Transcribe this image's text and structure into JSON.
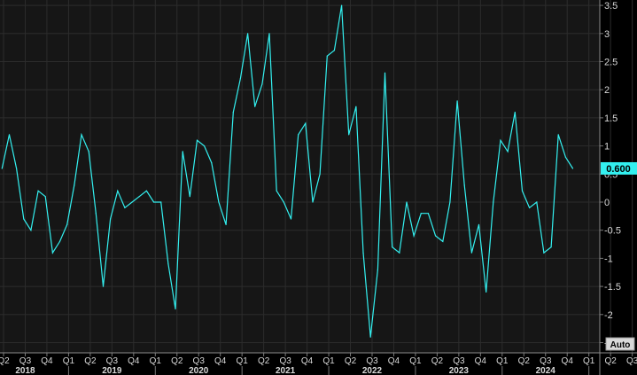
{
  "chart_data": {
    "type": "line",
    "title": "",
    "xlabel": "",
    "ylabel": "",
    "x": [
      "2017-Q4",
      "2017-Q4",
      "2018-Q1",
      "2018-Q1",
      "2018-Q1",
      "2018-Q2",
      "2018-Q2",
      "2018-Q2",
      "2018-Q3",
      "2018-Q3",
      "2018-Q3",
      "2018-Q4",
      "2018-Q4",
      "2018-Q4",
      "2019-Q1",
      "2019-Q1",
      "2019-Q1",
      "2019-Q2",
      "2019-Q2",
      "2019-Q2",
      "2019-Q3",
      "2019-Q3",
      "2019-Q3",
      "2019-Q4",
      "2019-Q4",
      "2019-Q4",
      "2020-Q1",
      "2020-Q1",
      "2020-Q1",
      "2020-Q2",
      "2020-Q2",
      "2020-Q2",
      "2020-Q3",
      "2020-Q3",
      "2020-Q3",
      "2020-Q4",
      "2020-Q4",
      "2020-Q4",
      "2021-Q1",
      "2021-Q1",
      "2021-Q1",
      "2021-Q2",
      "2021-Q2",
      "2021-Q2",
      "2021-Q3",
      "2021-Q3",
      "2021-Q3",
      "2021-Q4",
      "2021-Q4",
      "2021-Q4",
      "2022-Q1",
      "2022-Q1",
      "2022-Q1",
      "2022-Q2",
      "2022-Q2",
      "2022-Q2",
      "2022-Q3",
      "2022-Q3",
      "2022-Q3",
      "2022-Q4",
      "2022-Q4",
      "2022-Q4",
      "2023-Q1",
      "2023-Q1",
      "2023-Q1",
      "2023-Q2",
      "2023-Q2",
      "2023-Q2",
      "2023-Q3",
      "2023-Q3",
      "2023-Q3",
      "2023-Q4",
      "2023-Q4",
      "2023-Q4",
      "2024-Q1",
      "2024-Q1",
      "2024-Q1",
      "2024-Q2",
      "2024-Q2",
      "2024-Q2",
      "2024-Q3",
      "2024-Q3",
      "2024-Q3",
      "2024-Q4",
      "2024-Q4",
      "2024-Q4"
    ],
    "series": [
      {
        "color": "#33f0f0",
        "values": [
          0.6,
          1.2,
          0.6,
          -0.3,
          -0.5,
          0.2,
          0.1,
          -0.9,
          -0.7,
          -0.4,
          0.3,
          1.2,
          0.9,
          -0.2,
          -1.5,
          -0.3,
          0.2,
          -0.1,
          0.0,
          0.1,
          0.2,
          0.0,
          0.0,
          -1.1,
          -1.9,
          0.9,
          0.1,
          1.1,
          1.0,
          0.7,
          0.0,
          -0.4,
          1.6,
          2.2,
          3.0,
          1.7,
          2.1,
          3.0,
          0.2,
          0.0,
          -0.3,
          1.2,
          1.4,
          0.0,
          0.5,
          2.6,
          2.7,
          3.5,
          1.2,
          1.7,
          -0.9,
          -2.4,
          -1.2,
          2.3,
          -0.8,
          -0.9,
          0.0,
          -0.6,
          -0.2,
          -0.2,
          -0.6,
          -0.7,
          0.0,
          1.8,
          0.3,
          -0.9,
          -0.4,
          -1.6,
          0.0,
          1.1,
          0.9,
          1.6,
          0.2,
          -0.1,
          0.0,
          -0.9,
          -0.8,
          1.2,
          0.8,
          0.6
        ]
      }
    ],
    "y_ticks": [
      "3.5",
      "3",
      "2.5",
      "2",
      "1.5",
      "1",
      "0.5",
      "0",
      "-0.5",
      "-1",
      "-1.5",
      "-2",
      "-2.5"
    ],
    "ylim": [
      -2.6,
      3.6
    ],
    "x_quarter_ticks": [
      "Q2",
      "Q3",
      "Q4",
      "Q1",
      "Q2",
      "Q3",
      "Q4",
      "Q1",
      "Q2",
      "Q3",
      "Q4",
      "Q1",
      "Q2",
      "Q3",
      "Q4",
      "Q1",
      "Q2",
      "Q3",
      "Q4",
      "Q1",
      "Q2",
      "Q3",
      "Q4",
      "Q1",
      "Q2",
      "Q3",
      "Q4",
      "Q1",
      "Q2",
      "Q3",
      "Q4",
      "Q1"
    ],
    "x_year_labels": [
      "2018",
      "2019",
      "2020",
      "2021",
      "2022",
      "2023",
      "2024"
    ],
    "last_value_label": "0.600",
    "last_value": 0.6,
    "grid": true,
    "y_axis_button": "Auto",
    "colors": {
      "background": "#000000",
      "plot_background": "#161616",
      "grid": "#2c2c2c",
      "line": "#33f0f0",
      "axis_text": "#d8d8d8",
      "last_value_bg": "#33f0f0",
      "last_value_text": "#000000"
    }
  }
}
